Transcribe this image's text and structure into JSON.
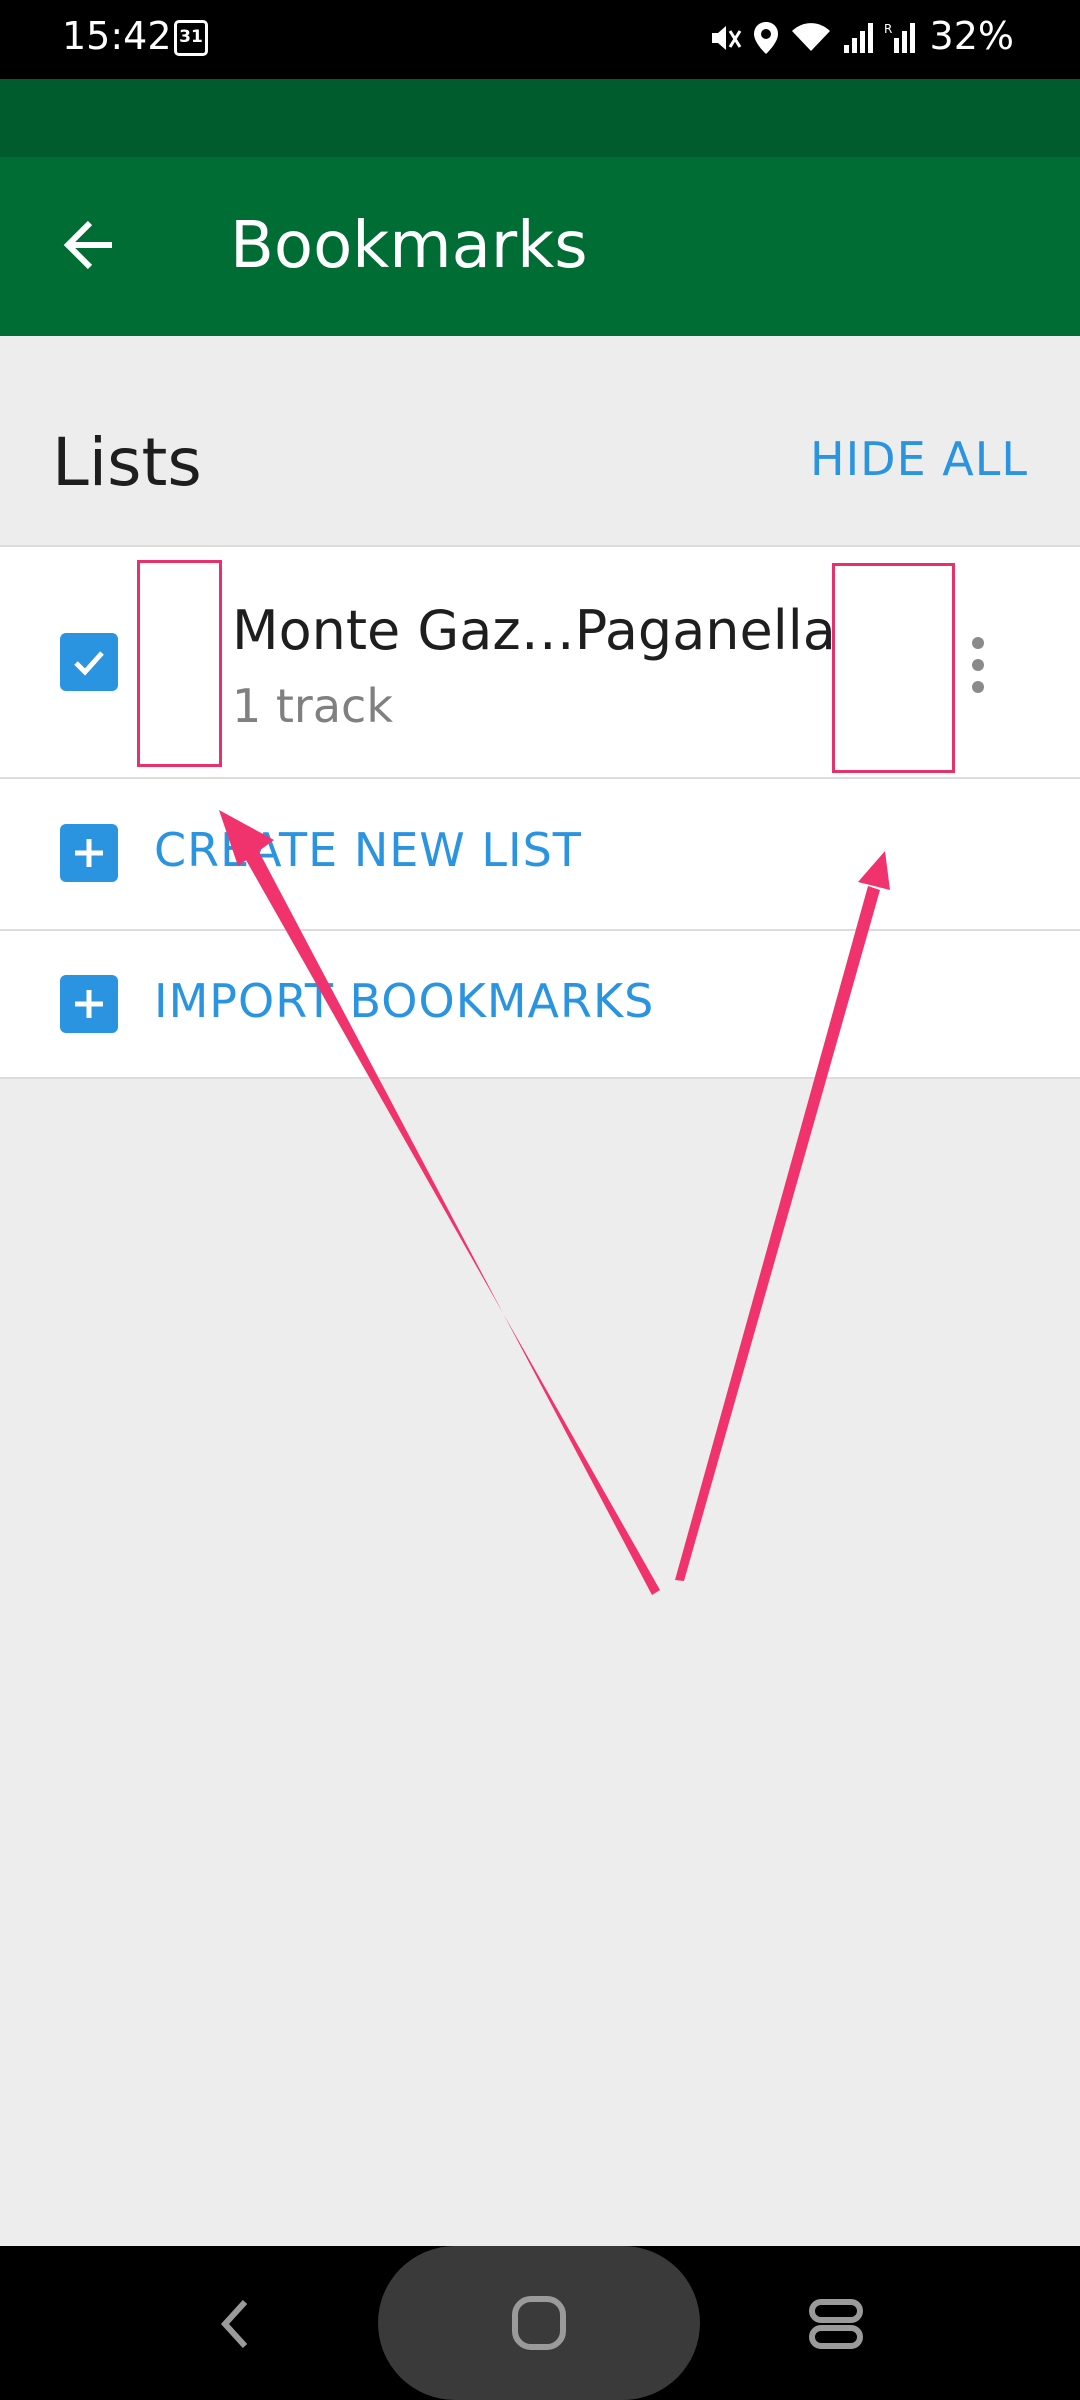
{
  "status_bar": {
    "time": "15:42",
    "calendar_day": "31",
    "battery": "32%"
  },
  "toolbar": {
    "title": "Bookmarks"
  },
  "lists_header": {
    "title": "Lists",
    "hide_all_label": "HIDE ALL"
  },
  "bookmark_lists": [
    {
      "name": "Monte Gaz…Paganella",
      "count": "1 track",
      "checked": true
    }
  ],
  "actions": {
    "create_label": "CREATE NEW LIST",
    "import_label": "IMPORT BOOKMARKS"
  },
  "colors": {
    "toolbar": "#006d35",
    "status_top": "#005c2c",
    "accent": "#2a94e0",
    "annotation": "#e8306a"
  },
  "icons": [
    "back-arrow-icon",
    "calendar-icon",
    "mute-icon",
    "location-icon",
    "wifi-icon",
    "signal-icon",
    "checkbox-icon",
    "more-vert-icon",
    "plus-icon",
    "nav-back-icon",
    "nav-home-icon",
    "nav-recents-icon"
  ]
}
